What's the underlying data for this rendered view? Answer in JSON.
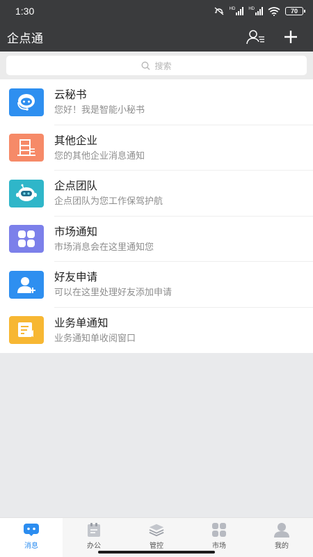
{
  "status_bar": {
    "time": "1:30",
    "battery": "70",
    "signal_label_1": "HD",
    "signal_label_2": "HD"
  },
  "header": {
    "title": "企点通"
  },
  "search": {
    "placeholder": "搜索"
  },
  "messages": [
    {
      "name": "云秘书",
      "desc": "您好！我是智能小秘书",
      "icon": "robot-headset-icon",
      "color": "#2e8ff0"
    },
    {
      "name": "其他企业",
      "desc": "您的其他企业消息通知",
      "icon": "enterprise-icon",
      "color": "#f68a68"
    },
    {
      "name": "企点团队",
      "desc": "企点团队为您工作保驾护航",
      "icon": "team-robot-icon",
      "color": "#2fb6c9"
    },
    {
      "name": "市场通知",
      "desc": "市场消息会在这里通知您",
      "icon": "grid-icon",
      "color": "#7c80ea"
    },
    {
      "name": "好友申请",
      "desc": "可以在这里处理好友添加申请",
      "icon": "add-friend-icon",
      "color": "#2e8ff0"
    },
    {
      "name": "业务单通知",
      "desc": "业务通知单收阅窗口",
      "icon": "order-notice-icon",
      "color": "#f7b733"
    }
  ],
  "tabs": [
    {
      "label": "消息",
      "active": true
    },
    {
      "label": "办公",
      "active": false
    },
    {
      "label": "管控",
      "active": false
    },
    {
      "label": "市场",
      "active": false
    },
    {
      "label": "我的",
      "active": false
    }
  ],
  "colors": {
    "accent": "#2c8df0",
    "header_bg": "#3a3b3d"
  }
}
